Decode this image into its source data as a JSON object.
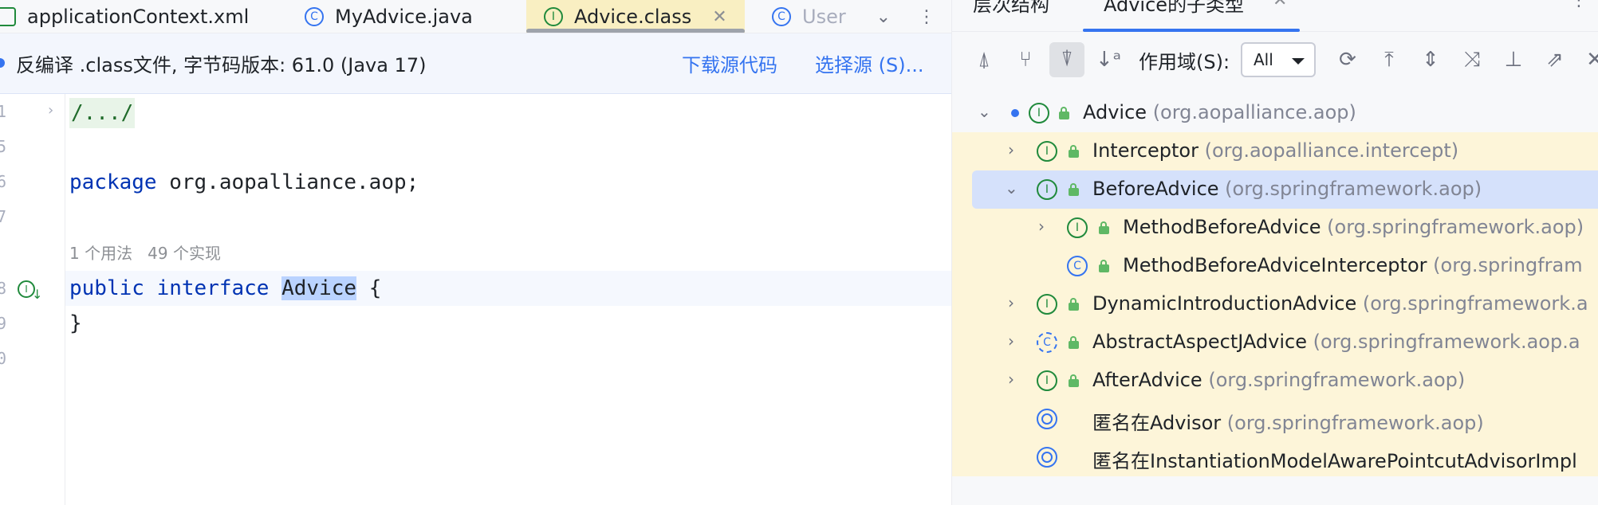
{
  "editor": {
    "tabs": [
      {
        "label": "applicationContext.xml",
        "icon": "xml-file-icon"
      },
      {
        "label": "MyAdvice.java",
        "icon": "class-icon"
      },
      {
        "label": "Advice.class",
        "icon": "interface-icon",
        "active": true
      },
      {
        "label": "User",
        "icon": "class-icon"
      }
    ],
    "decompile": {
      "message": "反编译 .class文件, 字节码版本: 61.0 (Java 17)",
      "download_source": "下载源代码",
      "choose_source": "选择源 (S)..."
    },
    "line_numbers": [
      "1",
      "5",
      "6",
      "7",
      "8",
      "9",
      "0"
    ],
    "code": {
      "fold": "/.../",
      "package_kw": "package",
      "package_name": " org.aopalliance.aop;",
      "usage_hint": "1 个用法   49 个实现",
      "public_kw": "public",
      "interface_kw": "interface",
      "class_name": "Advice",
      "open_brace": " {",
      "close_brace": "}"
    }
  },
  "hierarchy": {
    "panel_title": "层次结构",
    "tab_title": "Advice的子类型",
    "scope_label": "作用域(S):",
    "scope_value": "All",
    "items": [
      {
        "name": "Advice",
        "pkg": " (org.aopalliance.aop)",
        "kind": "interface",
        "expanded": true
      },
      {
        "name": "Interceptor",
        "pkg": " (org.aopalliance.intercept)",
        "kind": "interface",
        "expanded": false
      },
      {
        "name": "BeforeAdvice",
        "pkg": " (org.springframework.aop)",
        "kind": "interface",
        "expanded": true,
        "selected": true
      },
      {
        "name": "MethodBeforeAdvice",
        "pkg": " (org.springframework.aop)",
        "kind": "interface",
        "expanded": false
      },
      {
        "name": "MethodBeforeAdviceInterceptor",
        "pkg": " (org.springfram",
        "kind": "class"
      },
      {
        "name": "DynamicIntroductionAdvice",
        "pkg": " (org.springframework.a",
        "kind": "interface",
        "expanded": false
      },
      {
        "name": "AbstractAspectJAdvice",
        "pkg": " (org.springframework.aop.a",
        "kind": "abstract-class",
        "expanded": false
      },
      {
        "name": "AfterAdvice",
        "pkg": " (org.springframework.aop)",
        "kind": "interface",
        "expanded": false
      },
      {
        "name": "匿名在Advisor",
        "pkg": " (org.springframework.aop)",
        "kind": "anonymous"
      },
      {
        "name": "匿名在InstantiationModelAwarePointcutAdvisorImpl",
        "pkg": "",
        "kind": "anonymous"
      }
    ]
  },
  "colors": {
    "accent": "#3574f0",
    "interface_green": "#208a3c",
    "selected_row": "#d5e1fb",
    "highlight_row": "#fdf5d9",
    "active_tab": "#f9efc2"
  }
}
